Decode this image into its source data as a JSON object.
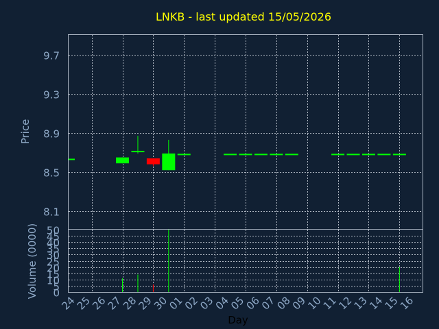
{
  "colors": {
    "background": "#112033",
    "title": "#ffff00",
    "axis_text": "#8ea8c6",
    "frame": "#aab4c2",
    "grid": "#c8ced8",
    "up": "#00ff00",
    "down": "#ff0000",
    "xlabel": "#000000"
  },
  "chart_data": {
    "type": "candlestick",
    "title": "LNKB - last updated 15/05/2026",
    "grid": true,
    "price_panel": {
      "ylabel": "Price",
      "ylim": [
        7.92,
        9.9
      ],
      "yticks": [
        8.1,
        8.5,
        8.9,
        9.3,
        9.7
      ],
      "ytick_labels": [
        "8.1",
        "8.5",
        "8.9",
        "9.3",
        "9.7"
      ]
    },
    "volume_panel": {
      "ylabel": "Volume (0000)",
      "ylim": [
        0,
        50
      ],
      "yticks": [
        0,
        5,
        10,
        15,
        20,
        25,
        30,
        35,
        40,
        45,
        50
      ],
      "ytick_labels": [
        "0",
        "5",
        "10",
        "15",
        "20",
        "25",
        "30",
        "35",
        "40",
        "45",
        "50"
      ]
    },
    "xlabel": "Day",
    "x_labels": [
      "24",
      "25",
      "26",
      "27",
      "28",
      "29",
      "30",
      "01",
      "02",
      "03",
      "04",
      "05",
      "06",
      "07",
      "08",
      "09",
      "10",
      "11",
      "12",
      "13",
      "14",
      "15",
      "16"
    ],
    "candles": [
      {
        "x": "24",
        "open": 8.63,
        "high": 8.63,
        "low": 8.63,
        "close": 8.63,
        "volume": 0
      },
      {
        "x": "27",
        "open": 8.59,
        "high": 8.65,
        "low": 8.59,
        "close": 8.65,
        "volume": 11
      },
      {
        "x": "28",
        "open": 8.7,
        "high": 8.87,
        "low": 8.69,
        "close": 8.71,
        "volume": 14
      },
      {
        "x": "29",
        "open": 8.64,
        "high": 8.64,
        "low": 8.56,
        "close": 8.58,
        "volume": 6
      },
      {
        "x": "30",
        "open": 8.52,
        "high": 8.83,
        "low": 8.52,
        "close": 8.69,
        "volume": 50
      },
      {
        "x": "01",
        "open": 8.68,
        "high": 8.68,
        "low": 8.68,
        "close": 8.68,
        "volume": 0
      },
      {
        "x": "04",
        "open": 8.68,
        "high": 8.68,
        "low": 8.68,
        "close": 8.68,
        "volume": 0
      },
      {
        "x": "05",
        "open": 8.68,
        "high": 8.68,
        "low": 8.68,
        "close": 8.68,
        "volume": 0
      },
      {
        "x": "06",
        "open": 8.68,
        "high": 8.68,
        "low": 8.68,
        "close": 8.68,
        "volume": 0
      },
      {
        "x": "07",
        "open": 8.68,
        "high": 8.68,
        "low": 8.68,
        "close": 8.68,
        "volume": 0
      },
      {
        "x": "08",
        "open": 8.68,
        "high": 8.68,
        "low": 8.68,
        "close": 8.68,
        "volume": 0
      },
      {
        "x": "11",
        "open": 8.68,
        "high": 8.68,
        "low": 8.68,
        "close": 8.68,
        "volume": 0
      },
      {
        "x": "12",
        "open": 8.68,
        "high": 8.68,
        "low": 8.68,
        "close": 8.68,
        "volume": 0
      },
      {
        "x": "13",
        "open": 8.68,
        "high": 8.68,
        "low": 8.68,
        "close": 8.68,
        "volume": 0
      },
      {
        "x": "14",
        "open": 8.68,
        "high": 8.68,
        "low": 8.68,
        "close": 8.68,
        "volume": 0
      },
      {
        "x": "15",
        "open": 8.68,
        "high": 8.68,
        "low": 8.68,
        "close": 8.68,
        "volume": 20
      }
    ]
  }
}
